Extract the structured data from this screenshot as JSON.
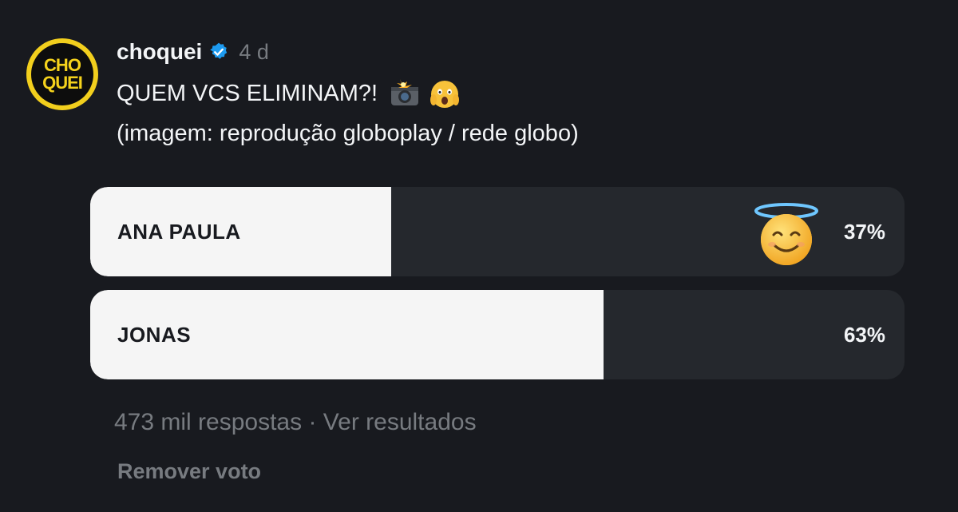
{
  "post": {
    "avatar_text_top": "CHO",
    "avatar_text_bottom": "QUEI",
    "username": "choquei",
    "verified_icon": "verified-badge-icon",
    "time_ago": "4 d",
    "caption_line1": "QUEM VCS ELIMINAM?!",
    "caption_emoji1": "camera-flash-emoji",
    "caption_emoji2": "screaming-face-emoji",
    "caption_line2": "(imagem: reprodução globoplay / rede globo)"
  },
  "poll": {
    "options": [
      {
        "label": "ANA PAULA",
        "percent_text": "37%",
        "fill_fraction": 0.37,
        "voted": true,
        "vote_icon": "smiling-face-with-halo-emoji"
      },
      {
        "label": "JONAS",
        "percent_text": "63%",
        "fill_fraction": 0.63,
        "voted": false
      }
    ],
    "responses": "473 mil respostas",
    "separator": "·",
    "view_results": "Ver resultados",
    "remove_vote": "Remover voto"
  },
  "colors": {
    "background": "#181a1f",
    "option_track": "#25282d",
    "option_fill": "#f5f5f5",
    "muted_text": "#777b80",
    "verified_blue": "#1d9bf0",
    "avatar_yellow": "#f2cf1d"
  }
}
